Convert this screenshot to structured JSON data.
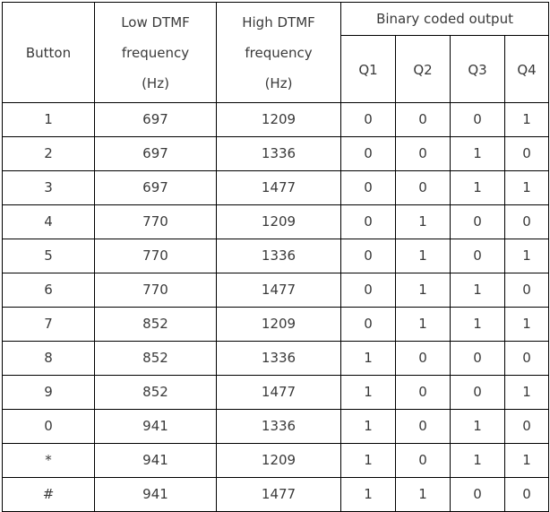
{
  "table": {
    "headers": {
      "button": "Button",
      "low_freq_lines": [
        "Low DTMF",
        "frequency",
        "(Hz)"
      ],
      "high_freq_lines": [
        "High DTMF",
        "frequency",
        "(Hz)"
      ],
      "binary_group": "Binary coded output",
      "q_columns": [
        "Q1",
        "Q2",
        "Q3",
        "Q4"
      ]
    },
    "rows": [
      {
        "button": "1",
        "low": "697",
        "high": "1209",
        "q1": "0",
        "q2": "0",
        "q3": "0",
        "q4": "1"
      },
      {
        "button": "2",
        "low": "697",
        "high": "1336",
        "q1": "0",
        "q2": "0",
        "q3": "1",
        "q4": "0"
      },
      {
        "button": "3",
        "low": "697",
        "high": "1477",
        "q1": "0",
        "q2": "0",
        "q3": "1",
        "q4": "1"
      },
      {
        "button": "4",
        "low": "770",
        "high": "1209",
        "q1": "0",
        "q2": "1",
        "q3": "0",
        "q4": "0"
      },
      {
        "button": "5",
        "low": "770",
        "high": "1336",
        "q1": "0",
        "q2": "1",
        "q3": "0",
        "q4": "1"
      },
      {
        "button": "6",
        "low": "770",
        "high": "1477",
        "q1": "0",
        "q2": "1",
        "q3": "1",
        "q4": "0"
      },
      {
        "button": "7",
        "low": "852",
        "high": "1209",
        "q1": "0",
        "q2": "1",
        "q3": "1",
        "q4": "1"
      },
      {
        "button": "8",
        "low": "852",
        "high": "1336",
        "q1": "1",
        "q2": "0",
        "q3": "0",
        "q4": "0"
      },
      {
        "button": "9",
        "low": "852",
        "high": "1477",
        "q1": "1",
        "q2": "0",
        "q3": "0",
        "q4": "1"
      },
      {
        "button": "0",
        "low": "941",
        "high": "1336",
        "q1": "1",
        "q2": "0",
        "q3": "1",
        "q4": "0"
      },
      {
        "button": "*",
        "low": "941",
        "high": "1209",
        "q1": "1",
        "q2": "0",
        "q3": "1",
        "q4": "1"
      },
      {
        "button": "#",
        "low": "941",
        "high": "1477",
        "q1": "1",
        "q2": "1",
        "q3": "0",
        "q4": "0"
      }
    ]
  },
  "colors": {
    "border": "#000000",
    "text": "#3a3a3a",
    "background": "#ffffff"
  }
}
